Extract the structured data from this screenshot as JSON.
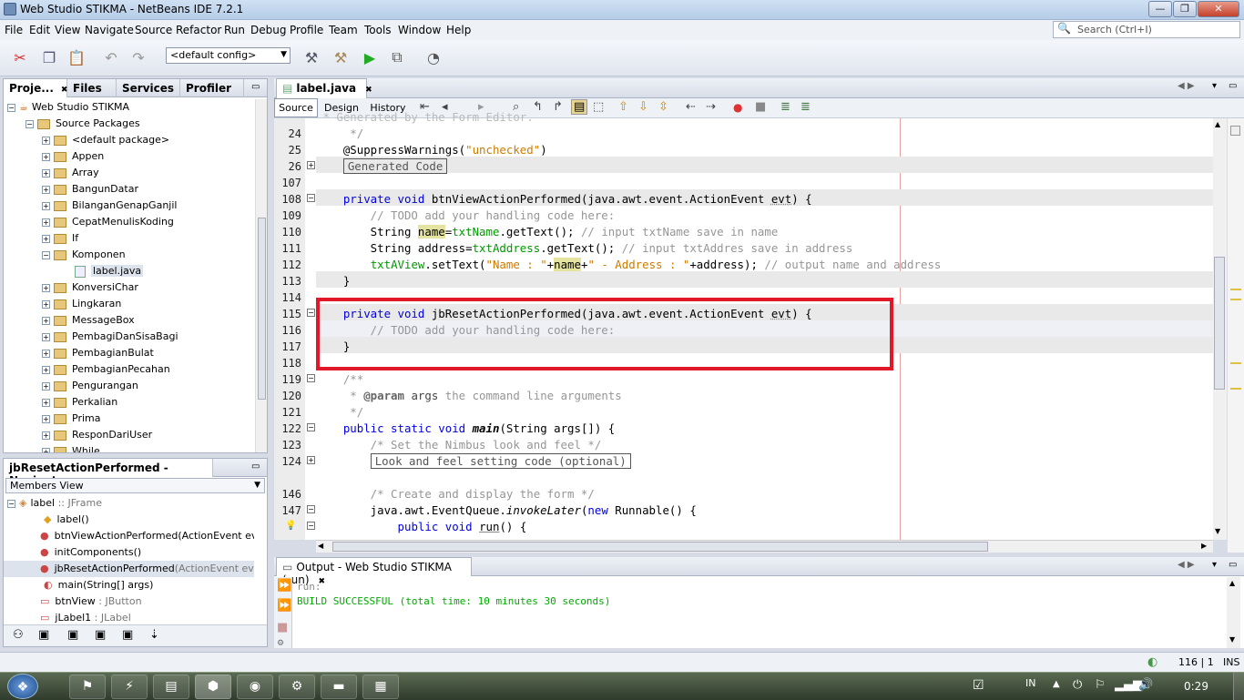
{
  "window": {
    "title": "Web Studio STIKMA - NetBeans IDE 7.2.1",
    "min": "—",
    "max": "❐",
    "close": "✕"
  },
  "menu": [
    "File",
    "Edit",
    "View",
    "Navigate",
    "Source",
    "Refactor",
    "Run",
    "Debug",
    "Profile",
    "Team",
    "Tools",
    "Window",
    "Help"
  ],
  "search": {
    "placeholder": "Search (Ctrl+I)"
  },
  "toolbar": {
    "config": "<default config>"
  },
  "projects_panel": {
    "tabs": [
      "Proje...",
      "Files",
      "Services",
      "Profiler"
    ],
    "root": "Web Studio STIKMA",
    "source_packages": "Source Packages",
    "packages": [
      "<default package>",
      "Appen",
      "Array",
      "BangunDatar",
      "BilanganGenapGanjil",
      "CepatMenulisKoding",
      "If",
      "Komponen"
    ],
    "komponen_child": "label.java",
    "packages2": [
      "KonversiChar",
      "Lingkaran",
      "MessageBox",
      "PembagiDanSisaBagi",
      "PembagianBulat",
      "PembagianPecahan",
      "Pengurangan",
      "Perkalian",
      "Prima",
      "ResponDariUser",
      "While"
    ]
  },
  "navigator": {
    "title": "jbResetActionPerformed - Navigator",
    "view": "Members View",
    "root": "label",
    "root_type": " :: JFrame",
    "members": [
      {
        "name": "label()",
        "detail": ""
      },
      {
        "name": "btnViewActionPerformed",
        "detail": "(ActionEvent evt)"
      },
      {
        "name": "initComponents()",
        "detail": ""
      },
      {
        "name": "jbResetActionPerformed",
        "detail": "(ActionEvent evt)"
      },
      {
        "name": "main",
        "detail": "(String[] args)"
      },
      {
        "name": "btnView",
        "detail": " : JButton"
      },
      {
        "name": "jLabel1",
        "detail": " : JLabel"
      }
    ]
  },
  "editor": {
    "file_tab": "label.java",
    "view_tabs": [
      "Source",
      "Design",
      "History"
    ],
    "lines": [
      {
        "n": "",
        "t": " * Generated by the Form Editor."
      },
      {
        "n": "24",
        "t": "     */"
      },
      {
        "n": "25",
        "t": "    @SuppressWarnings(\"unchecked\")"
      },
      {
        "n": "26",
        "t": "    Generated Code"
      },
      {
        "n": "107",
        "t": ""
      },
      {
        "n": "108",
        "t": "    private void btnViewActionPerformed(java.awt.event.ActionEvent evt) {"
      },
      {
        "n": "109",
        "t": "        // TODO add your handling code here:"
      },
      {
        "n": "110",
        "t": "        String name=txtName.getText(); // input txtName save in name"
      },
      {
        "n": "111",
        "t": "        String address=txtAddress.getText(); // input txtAddres save in address"
      },
      {
        "n": "112",
        "t": "        txtAView.setText(\"Name : \"+name+\" - Address : \"+address); // output name and address"
      },
      {
        "n": "113",
        "t": "    }"
      },
      {
        "n": "114",
        "t": ""
      },
      {
        "n": "115",
        "t": "    private void jbResetActionPerformed(java.awt.event.ActionEvent evt) {"
      },
      {
        "n": "116",
        "t": "        // TODO add your handling code here:"
      },
      {
        "n": "117",
        "t": "    }"
      },
      {
        "n": "118",
        "t": ""
      },
      {
        "n": "119",
        "t": "    /**"
      },
      {
        "n": "120",
        "t": "     * @param args the command line arguments"
      },
      {
        "n": "121",
        "t": "     */"
      },
      {
        "n": "122",
        "t": "    public static void main(String args[]) {"
      },
      {
        "n": "123",
        "t": "        /* Set the Nimbus look and feel */"
      },
      {
        "n": "124",
        "t": "        Look and feel setting code (optional)"
      },
      {
        "n": "146",
        "t": ""
      },
      {
        "n": "",
        "t": "        /* Create and display the form */"
      },
      {
        "n": "147",
        "t": "        java.awt.EventQueue.invokeLater(new Runnable() {"
      },
      {
        "n": "",
        "t": "            public void run() {"
      }
    ]
  },
  "output": {
    "title": "Output - Web Studio STIKMA (run)",
    "lines": [
      "run:",
      "BUILD SUCCESSFUL (total time: 10 minutes 30 seconds)"
    ]
  },
  "status": {
    "position": "116 | 1",
    "mode": "INS"
  },
  "taskbar": {
    "lang": "IN",
    "time": "0:29"
  }
}
